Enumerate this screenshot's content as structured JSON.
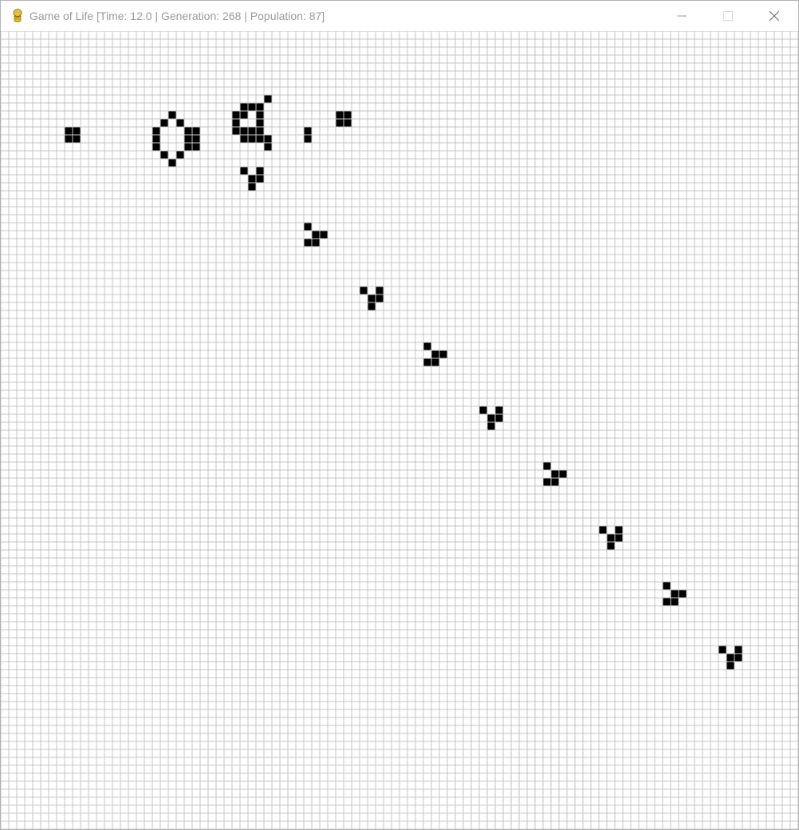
{
  "window": {
    "title": "Game of Life [Time: 12.0 | Generation: 268 | Population: 87]",
    "app_icon": "python-snake-icon",
    "controls": [
      "minimize-icon",
      "maximize-icon",
      "close-icon"
    ]
  },
  "colors": {
    "title_text": "#9a9a9a",
    "grid_line": "#c4c4c4",
    "cell_alive": "#000000",
    "background": "#ffffff"
  },
  "grid": {
    "columns": 100,
    "rows": 100,
    "live_cells": [
      [
        8,
        12
      ],
      [
        9,
        12
      ],
      [
        8,
        13
      ],
      [
        9,
        13
      ],
      [
        21,
        10
      ],
      [
        20,
        11
      ],
      [
        22,
        11
      ],
      [
        19,
        12
      ],
      [
        19,
        13
      ],
      [
        19,
        14
      ],
      [
        20,
        15
      ],
      [
        22,
        15
      ],
      [
        21,
        16
      ],
      [
        23,
        12
      ],
      [
        24,
        12
      ],
      [
        23,
        13
      ],
      [
        24,
        13
      ],
      [
        23,
        14
      ],
      [
        24,
        14
      ],
      [
        33,
        8
      ],
      [
        30,
        9
      ],
      [
        31,
        9
      ],
      [
        32,
        9
      ],
      [
        29,
        10
      ],
      [
        30,
        10
      ],
      [
        32,
        10
      ],
      [
        29,
        11
      ],
      [
        32,
        11
      ],
      [
        29,
        12
      ],
      [
        30,
        12
      ],
      [
        31,
        12
      ],
      [
        32,
        12
      ],
      [
        30,
        13
      ],
      [
        31,
        13
      ],
      [
        32,
        13
      ],
      [
        33,
        13
      ],
      [
        33,
        14
      ],
      [
        38,
        12
      ],
      [
        38,
        13
      ],
      [
        42,
        10
      ],
      [
        43,
        10
      ],
      [
        42,
        11
      ],
      [
        43,
        11
      ],
      [
        30,
        17
      ],
      [
        32,
        17
      ],
      [
        31,
        18
      ],
      [
        32,
        18
      ],
      [
        31,
        19
      ],
      [
        38,
        24
      ],
      [
        39,
        25
      ],
      [
        40,
        25
      ],
      [
        38,
        26
      ],
      [
        39,
        26
      ],
      [
        45,
        32
      ],
      [
        47,
        32
      ],
      [
        46,
        33
      ],
      [
        47,
        33
      ],
      [
        46,
        34
      ],
      [
        53,
        39
      ],
      [
        54,
        40
      ],
      [
        55,
        40
      ],
      [
        53,
        41
      ],
      [
        54,
        41
      ],
      [
        60,
        47
      ],
      [
        62,
        47
      ],
      [
        61,
        48
      ],
      [
        62,
        48
      ],
      [
        61,
        49
      ],
      [
        68,
        54
      ],
      [
        69,
        55
      ],
      [
        70,
        55
      ],
      [
        68,
        56
      ],
      [
        69,
        56
      ],
      [
        75,
        62
      ],
      [
        77,
        62
      ],
      [
        76,
        63
      ],
      [
        77,
        63
      ],
      [
        76,
        64
      ],
      [
        83,
        69
      ],
      [
        84,
        70
      ],
      [
        85,
        70
      ],
      [
        83,
        71
      ],
      [
        84,
        71
      ],
      [
        90,
        77
      ],
      [
        92,
        77
      ],
      [
        91,
        78
      ],
      [
        92,
        78
      ],
      [
        91,
        79
      ]
    ]
  }
}
